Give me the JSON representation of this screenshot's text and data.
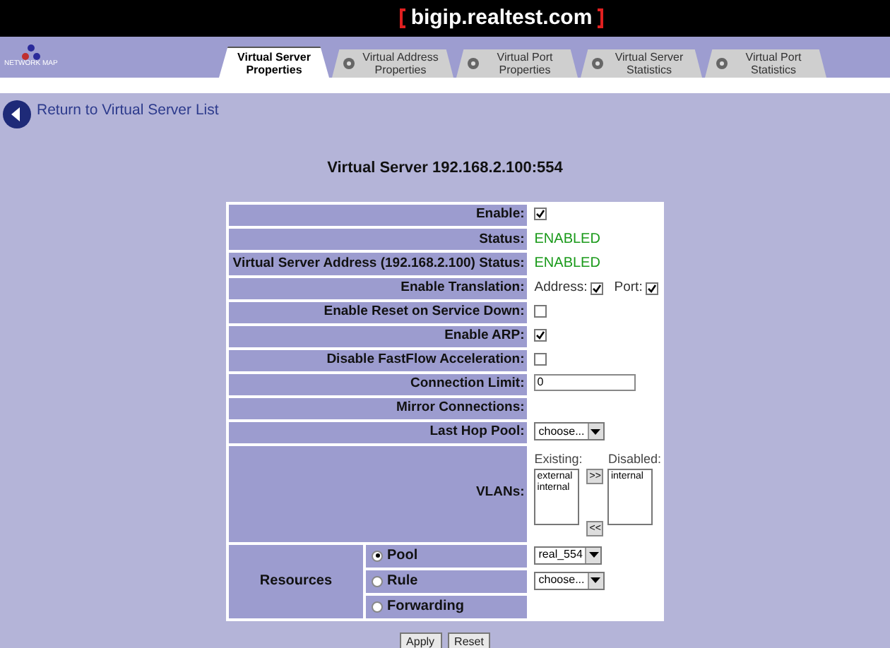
{
  "header": {
    "title": "bigip.realtest.com"
  },
  "logo": {
    "caption": "NETWORK MAP"
  },
  "tabs": [
    {
      "label": "Virtual Server Properties",
      "selected": true
    },
    {
      "label": "Virtual Address Properties",
      "selected": false
    },
    {
      "label": "Virtual Port Properties",
      "selected": false
    },
    {
      "label": "Virtual Server Statistics",
      "selected": false
    },
    {
      "label": "Virtual Port Statistics",
      "selected": false
    }
  ],
  "back_link": "Return to Virtual Server List",
  "heading": "Virtual Server 192.168.2.100:554",
  "rows": [
    {
      "kind": "checkbox",
      "label": "Enable:",
      "checked": true
    },
    {
      "kind": "status",
      "label": "Status:",
      "value": "ENABLED"
    },
    {
      "kind": "status",
      "label": "Virtual Server Address (192.168.2.100) Status:",
      "value": "ENABLED"
    },
    {
      "kind": "pair",
      "label": "Enable Translation:",
      "options": [
        {
          "label": "Address:",
          "checked": true
        },
        {
          "label": "Port:",
          "checked": true
        }
      ]
    },
    {
      "kind": "checkbox",
      "label": "Enable Reset on Service Down:",
      "checked": false
    },
    {
      "kind": "checkbox",
      "label": "Enable ARP:",
      "checked": true
    },
    {
      "kind": "checkbox",
      "label": "Disable FastFlow Acceleration:",
      "checked": false
    },
    {
      "kind": "text",
      "label": "Connection Limit:",
      "value": "0"
    },
    {
      "kind": "empty",
      "label": "Mirror Connections:"
    },
    {
      "kind": "select",
      "label": "Last Hop Pool:",
      "value": "choose..."
    },
    {
      "kind": "vlans",
      "label": "VLANs:",
      "existing_label": "Existing:",
      "disabled_label": "Disabled:",
      "existing": [
        "external",
        "internal"
      ],
      "disabled": [
        "internal"
      ],
      "add_button": ">>",
      "remove_button": "<<"
    }
  ],
  "resources": {
    "label": "Resources",
    "options": [
      {
        "label": "Pool",
        "selected": true,
        "value": "real_554"
      },
      {
        "label": "Rule",
        "selected": false,
        "value": "choose..."
      },
      {
        "label": "Forwarding",
        "selected": false
      }
    ]
  },
  "buttons": [
    "Apply",
    "Reset"
  ]
}
